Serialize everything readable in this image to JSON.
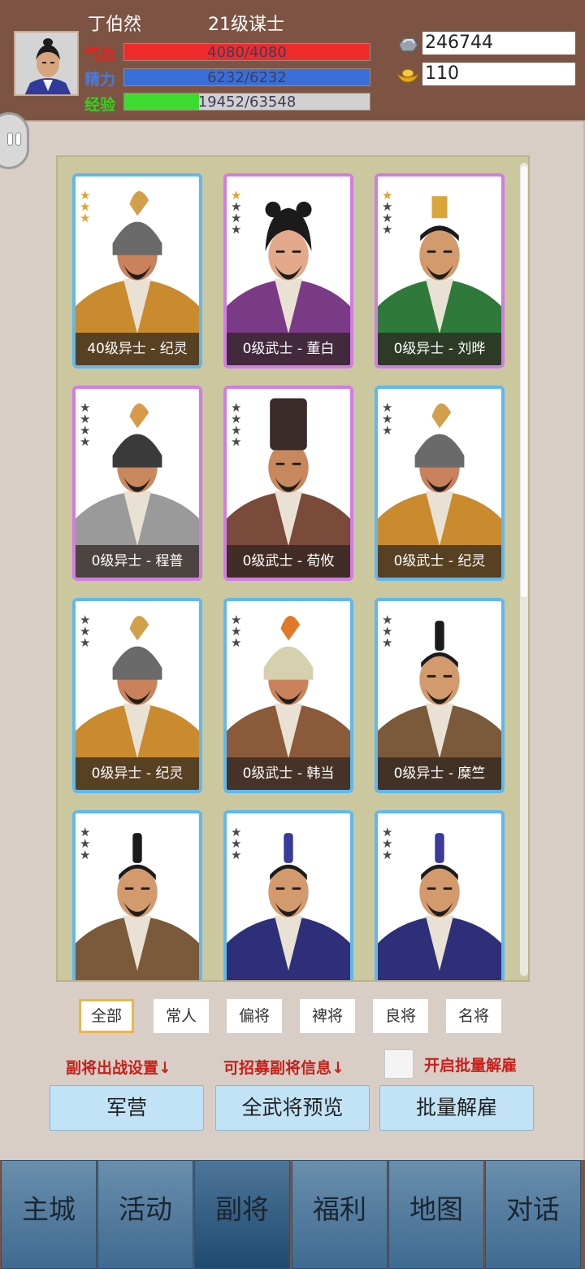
{
  "player": {
    "name": "丁伯然",
    "level_title": "21级谋士",
    "hp_label": "气血",
    "hp_text": "4080/4080",
    "hp_fraction": 1.0,
    "hp_color": "#ee2b2b",
    "energy_label": "精力",
    "energy_text": "6232/6232",
    "energy_fraction": 1.0,
    "energy_color": "#3a6fd9",
    "exp_label": "经验",
    "exp_text": "19452/63548",
    "exp_fraction": 0.306,
    "exp_color": "#3ddb2f"
  },
  "resources": {
    "silver": "246744",
    "gold": "110"
  },
  "generals": [
    {
      "label": "40级异士 - 纪灵",
      "frame": "blue",
      "gold_stars": 3,
      "gray_stars": 0
    },
    {
      "label": "0级武士 - 董白",
      "frame": "purple",
      "gold_stars": 1,
      "gray_stars": 3
    },
    {
      "label": "0级异士 - 刘晔",
      "frame": "purple",
      "gold_stars": 1,
      "gray_stars": 3
    },
    {
      "label": "0级异士 - 程普",
      "frame": "purple",
      "gold_stars": 0,
      "gray_stars": 4
    },
    {
      "label": "0级武士 - 荀攸",
      "frame": "purple",
      "gold_stars": 0,
      "gray_stars": 4
    },
    {
      "label": "0级武士 - 纪灵",
      "frame": "blue",
      "gold_stars": 0,
      "gray_stars": 3
    },
    {
      "label": "0级异士 - 纪灵",
      "frame": "blue",
      "gold_stars": 0,
      "gray_stars": 3
    },
    {
      "label": "0级武士 - 韩当",
      "frame": "blue",
      "gold_stars": 0,
      "gray_stars": 3
    },
    {
      "label": "0级异士 - 糜竺",
      "frame": "blue",
      "gold_stars": 0,
      "gray_stars": 3
    },
    {
      "label": "",
      "frame": "blue",
      "gold_stars": 0,
      "gray_stars": 3
    },
    {
      "label": "",
      "frame": "blue",
      "gold_stars": 0,
      "gray_stars": 3
    },
    {
      "label": "",
      "frame": "blue",
      "gold_stars": 0,
      "gray_stars": 3
    }
  ],
  "filters": [
    "全部",
    "常人",
    "偏将",
    "裨将",
    "良将",
    "名将"
  ],
  "active_filter": 0,
  "labels": {
    "deploy_settings": "副将出战设置↓",
    "recruit_info": "可招募副将信息↓",
    "batch_dismiss_toggle": "开启批量解雇"
  },
  "actions": {
    "barracks": "军营",
    "preview_all": "全武将预览",
    "batch_dismiss": "批量解雇"
  },
  "nav": [
    "主城",
    "活动",
    "副将",
    "福利",
    "地图",
    "对话"
  ],
  "active_nav": 2
}
